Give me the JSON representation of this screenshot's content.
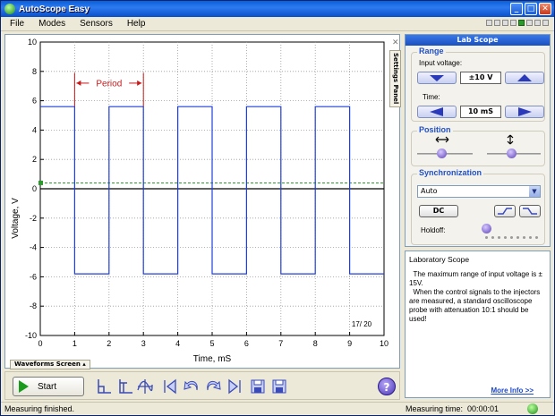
{
  "window": {
    "title": "AutoScope Easy"
  },
  "menu": {
    "items": [
      "File",
      "Modes",
      "Sensors",
      "Help"
    ]
  },
  "scope": {
    "y_axis_label": "Voltage, V",
    "x_axis_label": "Time, mS",
    "y_ticks": [
      "10",
      "8",
      "6",
      "4",
      "2",
      "0",
      "-2",
      "-4",
      "-6",
      "-8",
      "-10"
    ],
    "x_ticks": [
      "0",
      "1",
      "2",
      "3",
      "4",
      "5",
      "6",
      "7",
      "8",
      "9",
      "10"
    ],
    "period_label": "Period",
    "frame_counter": "17/ 20",
    "trigger_level_v": 0.4,
    "signal_high_v": 5.6,
    "signal_low_v": -5.8,
    "signal_color": "#1f3fd8",
    "trigger_color": "#2a9a2a",
    "period_color": "#c81818"
  },
  "chart_data": {
    "type": "line",
    "title": "",
    "xlabel": "Time, mS",
    "ylabel": "Voltage, V",
    "xlim": [
      0,
      10
    ],
    "ylim": [
      -10,
      10
    ],
    "grid": true,
    "series": [
      {
        "x": [
          0,
          1,
          1,
          2,
          2,
          3,
          3,
          4,
          4,
          5,
          5,
          6,
          6,
          7,
          7,
          8,
          8,
          9,
          9,
          10
        ],
        "values": [
          5.6,
          5.6,
          -5.8,
          -5.8,
          5.6,
          5.6,
          -5.8,
          -5.8,
          5.6,
          5.6,
          -5.8,
          -5.8,
          5.6,
          5.6,
          -5.8,
          -5.8,
          5.6,
          5.6,
          -5.8,
          -5.8
        ]
      }
    ],
    "annotations": [
      "Period",
      "17/ 20"
    ]
  },
  "tabs": {
    "settings_panel": "Settings Panel",
    "waveforms_screen": "Waveforms Screen"
  },
  "toolbar": {
    "start_label": "Start",
    "help_icon": "?"
  },
  "lab_scope": {
    "header": "Lab Scope",
    "range_title": "Range",
    "input_voltage_label": "Input voltage:",
    "input_voltage_value": "±10 V",
    "time_label": "Time:",
    "time_value": "10 mS",
    "position_title": "Position",
    "sync_title": "Synchronization",
    "sync_mode": "Auto",
    "coupling": "DC",
    "holdoff_label": "Holdoff:"
  },
  "info": {
    "title": "Laboratory Scope",
    "body": "  The maximum range of input voltage is ± 15V.\n  When the control signals to the injectors are measured, a standard oscilloscope probe with attenuation 10:1 should be used!",
    "more_info": "More Info >>"
  },
  "status": {
    "left": "Measuring finished.",
    "time_label": "Measuring time:",
    "time_value": "00:00:01"
  }
}
